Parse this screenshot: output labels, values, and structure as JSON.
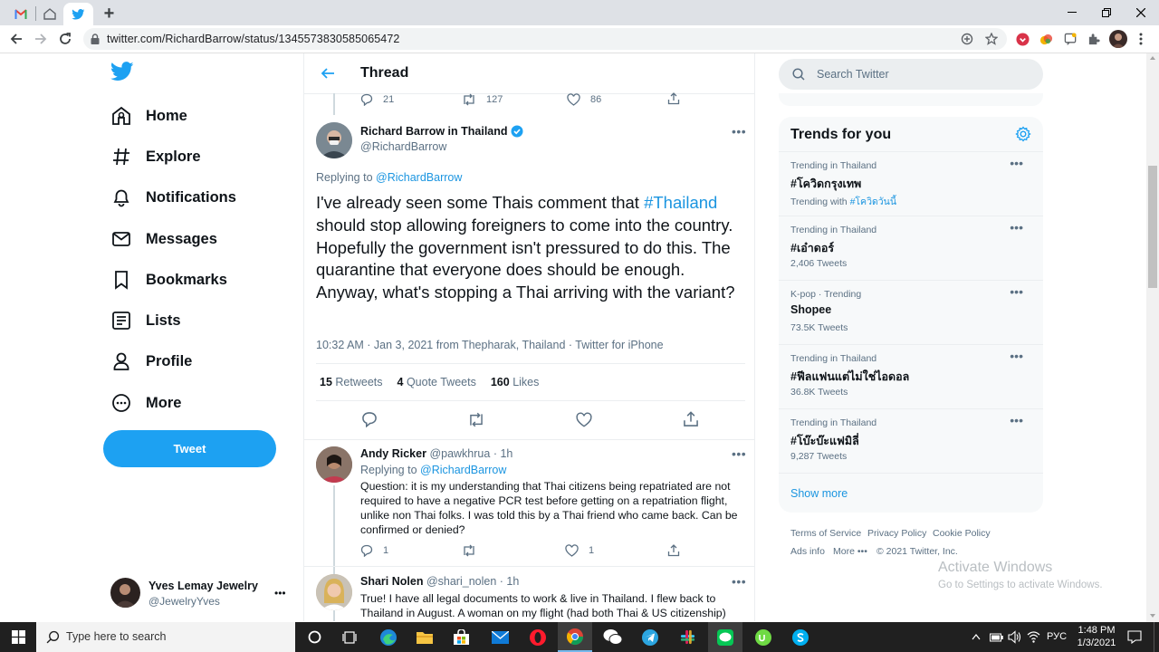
{
  "browser": {
    "url": "twitter.com/RichardBarrow/status/1345573830585065472",
    "new_tab": "+"
  },
  "nav": {
    "items": [
      {
        "label": "Home",
        "icon": "home-icon"
      },
      {
        "label": "Explore",
        "icon": "hash-icon"
      },
      {
        "label": "Notifications",
        "icon": "bell-icon"
      },
      {
        "label": "Messages",
        "icon": "mail-icon"
      },
      {
        "label": "Bookmarks",
        "icon": "bookmark-icon"
      },
      {
        "label": "Lists",
        "icon": "list-icon"
      },
      {
        "label": "Profile",
        "icon": "person-icon"
      },
      {
        "label": "More",
        "icon": "more-circle-icon"
      }
    ],
    "tweet_button": "Tweet",
    "account": {
      "name": "Yves Lemay Jewelry",
      "handle": "@JewelryYves",
      "more": "•••"
    }
  },
  "thread": {
    "header": "Thread",
    "prev_stats": {
      "replies": "21",
      "retweets": "127",
      "likes": "86"
    },
    "main": {
      "name": "Richard Barrow in Thailand",
      "handle": "@RichardBarrow",
      "replying_prefix": "Replying to",
      "replying_to": "@RichardBarrow",
      "text_1": "I've already seen some Thais comment that ",
      "hashtag": "#Thailand",
      "text_2": " should stop allowing foreigners to come into the country. Hopefully the government isn't pressured to do this. The quarantine that everyone does should be enough. Anyway, what's stopping a Thai arriving with the variant?",
      "meta": "10:32 AM · Jan 3, 2021 from Thepharak, Thailand · Twitter for iPhone",
      "retweets_num": "15",
      "retweets_lbl": "Retweets",
      "quotes_num": "4",
      "quotes_lbl": "Quote Tweets",
      "likes_num": "160",
      "likes_lbl": "Likes"
    },
    "replies": [
      {
        "name": "Andy Ricker",
        "handle": "@pawkhrua",
        "time": "· 1h",
        "replying_prefix": "Replying to",
        "replying_to": "@RichardBarrow",
        "text": "Question: it is my understanding that Thai citizens being repatriated are not required to have a negative PCR test before getting on a repatriation flight, unlike non Thai folks. I was told this by a Thai friend who came back. Can be confirmed or denied?",
        "replies": "1",
        "likes": "1"
      },
      {
        "name": "Shari Nolen",
        "handle": "@shari_nolen",
        "time": "· 1h",
        "text": "True! I have all legal documents to work & live in Thailand.  I flew back to Thailand in August. A woman on my flight (had both Thai & US citizenship)"
      }
    ]
  },
  "right": {
    "search_placeholder": "Search Twitter",
    "trends_title": "Trends for you",
    "trends": [
      {
        "meta": "Trending in Thailand",
        "name": "#โควิดกรุงเทพ",
        "extra_prefix": "Trending with ",
        "extra_link": "#โควิดวันนี้"
      },
      {
        "meta": "Trending in Thailand",
        "name": "#เอ๋าดอร์",
        "count": "2,406 Tweets"
      },
      {
        "meta": "K-pop · Trending",
        "name": "Shopee",
        "count": "73.5K Tweets"
      },
      {
        "meta": "Trending in Thailand",
        "name": "#ฟีลแฟนแต่ไม่ใช่ไอดอล",
        "count": "36.8K Tweets"
      },
      {
        "meta": "Trending in Thailand",
        "name": "#โบ๊ะบ๊ะแฟมิลี่",
        "count": "9,287 Tweets"
      }
    ],
    "show_more": "Show more",
    "footer": {
      "terms": "Terms of Service",
      "privacy": "Privacy Policy",
      "cookie": "Cookie Policy",
      "ads": "Ads info",
      "more": "More •••",
      "copyright": "© 2021 Twitter, Inc."
    },
    "watermark_1": "Activate Windows",
    "watermark_2": "Go to Settings to activate Windows."
  },
  "taskbar": {
    "search_placeholder": "Type here to search",
    "lang": "РУС",
    "time": "1:48 PM",
    "date": "1/3/2021"
  },
  "colors": {
    "accent": "#1da1f2",
    "link": "#1b95e0",
    "text": "#0f1419",
    "secondary": "#5b7083"
  }
}
